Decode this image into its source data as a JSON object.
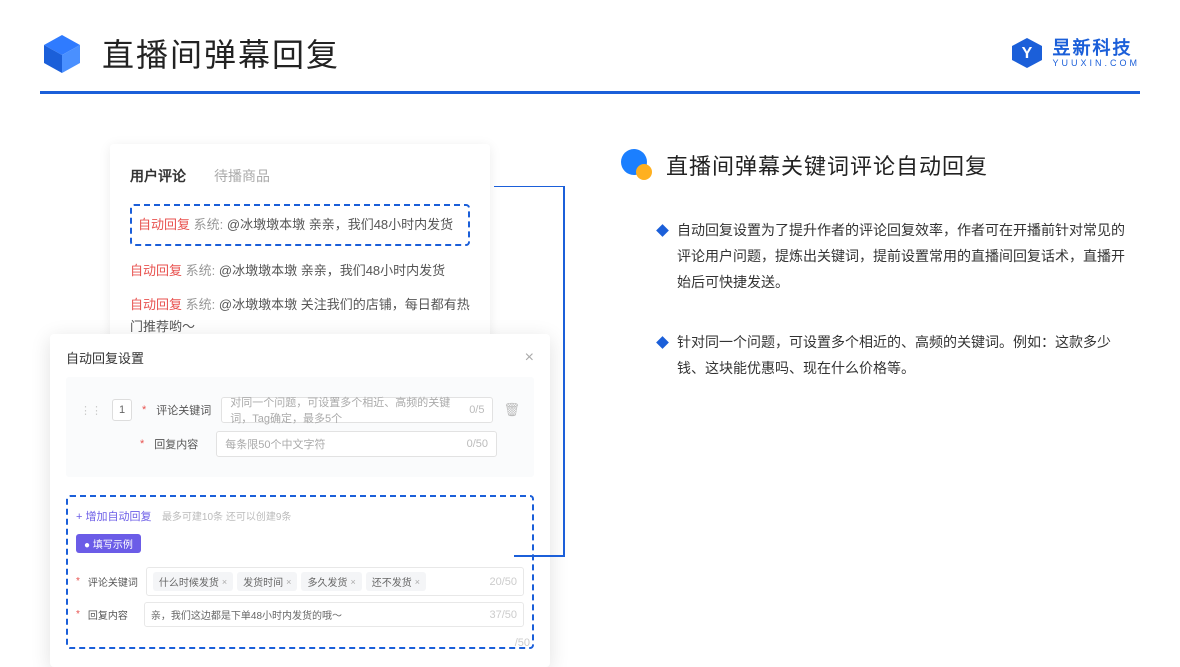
{
  "header": {
    "title": "直播间弹幕回复",
    "brand_cn": "昱新科技",
    "brand_en": "YUUXIN.COM"
  },
  "comments": {
    "tab_active": "用户评论",
    "tab_inactive": "待播商品",
    "highlighted": {
      "badge": "自动回复",
      "sys": "系统:",
      "text": "@冰墩墩本墩 亲亲，我们48小时内发货"
    },
    "list": [
      {
        "badge": "自动回复",
        "sys": "系统:",
        "text": "@冰墩墩本墩 亲亲，我们48小时内发货"
      },
      {
        "badge": "自动回复",
        "sys": "系统:",
        "text": "@冰墩墩本墩 关注我们的店铺，每日都有热门推荐哟～"
      }
    ]
  },
  "settings": {
    "title": "自动回复设置",
    "index": "1",
    "keyword_label": "评论关键词",
    "keyword_placeholder": "对同一个问题，可设置多个相近、高频的关键词，Tag确定，最多5个",
    "keyword_count": "0/5",
    "content_label": "回复内容",
    "content_placeholder": "每条限50个中文字符",
    "content_count": "0/50",
    "add_link": "+ 增加自动回复",
    "add_hint": "最多可建10条 还可以创建9条",
    "example_badge": "● 填写示例",
    "example_keyword_label": "评论关键词",
    "example_tags": [
      "什么时候发货",
      "发货时间",
      "多久发货",
      "还不发货"
    ],
    "example_kw_count": "20/50",
    "example_content_label": "回复内容",
    "example_content_value": "亲，我们这边都是下单48小时内发货的哦～",
    "example_content_count": "37/50",
    "stray_count": "/50"
  },
  "right": {
    "title": "直播间弹幕关键词评论自动回复",
    "bullets": [
      "自动回复设置为了提升作者的评论回复效率，作者可在开播前针对常见的评论用户问题，提炼出关键词，提前设置常用的直播间回复话术，直播开始后可快捷发送。",
      "针对同一个问题，可设置多个相近的、高频的关键词。例如：这款多少钱、这块能优惠吗、现在什么价格等。"
    ]
  }
}
